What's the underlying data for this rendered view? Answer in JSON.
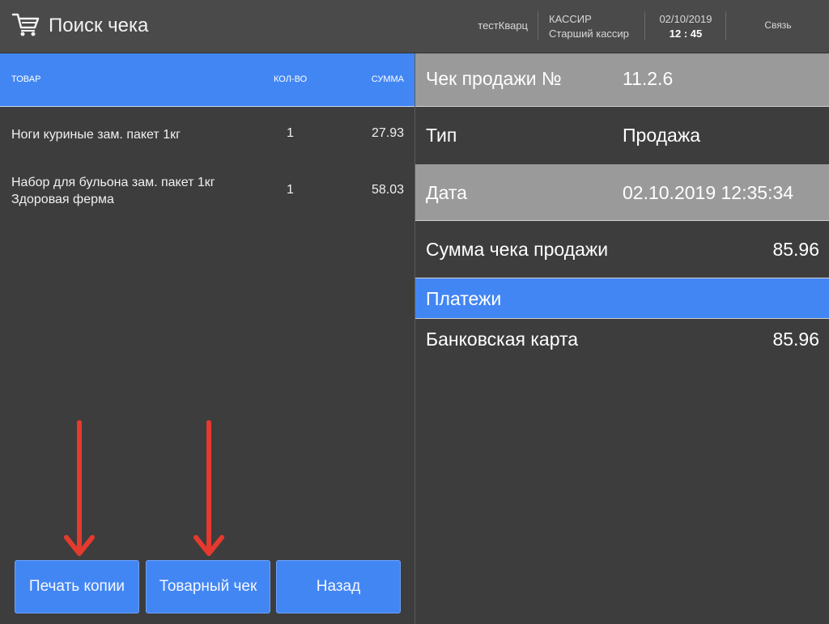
{
  "header": {
    "title": "Поиск чека",
    "user": "тестКварц",
    "role_label": "КАССИР",
    "role_name": "Старший кассир",
    "date": "02/10/2019",
    "time": "12 : 45",
    "link": "Связь"
  },
  "items_table": {
    "columns": [
      "ТОВАР",
      "КОЛ-ВО",
      "СУММА"
    ],
    "rows": [
      {
        "name_line1": "Ноги куриные зам. пакет 1кг",
        "name_line2": "",
        "qty": "1",
        "sum": "27.93"
      },
      {
        "name_line1": "Набор для бульона зам. пакет 1кг",
        "name_line2": "Здоровая ферма",
        "qty": "1",
        "sum": "58.03"
      }
    ]
  },
  "buttons": {
    "print_copy": "Печать копии",
    "goods_receipt": "Товарный чек",
    "back": "Назад"
  },
  "receipt": {
    "number_label": "Чек продажи №",
    "number_value": "11.2.6",
    "type_label": "Тип",
    "type_value": "Продажа",
    "date_label": "Дата",
    "date_value": "02.10.2019 12:35:34",
    "total_label": "Сумма чека продажи",
    "total_value": "85.96",
    "payments_label": "Платежи",
    "payment_method": "Банковская карта",
    "payment_value": "85.96"
  },
  "colors": {
    "accent_blue": "#4286f4",
    "header_bg": "#4a4a4a",
    "panel_bg": "#3d3d3d",
    "gray_row": "#9a9a9a",
    "annotation_arrow": "#e53a2f"
  },
  "icons": {
    "app_icon": "shopping-cart-icon",
    "annotation": "red-arrow-down-icon"
  }
}
